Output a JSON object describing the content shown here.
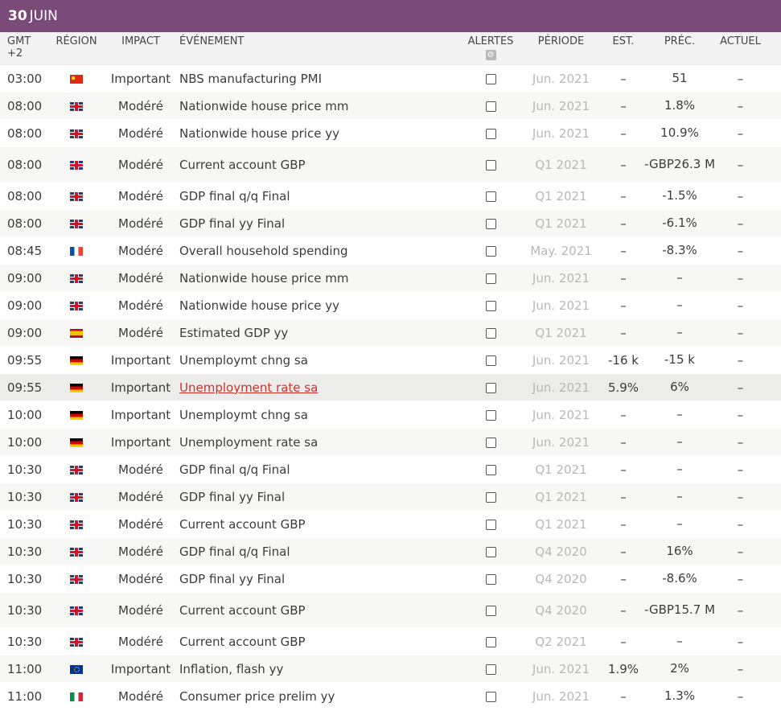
{
  "day": {
    "number": "30",
    "month": "JUIN"
  },
  "columns": {
    "time": "GMT +2",
    "region": "RÉGION",
    "impact": "IMPACT",
    "event": "ÉVÉNEMENT",
    "alerts": "ALERTES",
    "period": "PÉRIODE",
    "est": "EST.",
    "prec": "PRÉC.",
    "actual": "ACTUEL"
  },
  "rows": [
    {
      "time": "03:00",
      "flag": "cn",
      "impact": "Important",
      "event": "NBS manufacturing PMI",
      "period": "Jun. 2021",
      "est": "–",
      "prec": "51",
      "actual": "–"
    },
    {
      "time": "08:00",
      "flag": "gb",
      "impact": "Modéré",
      "event": "Nationwide house price mm",
      "period": "Jun. 2021",
      "est": "–",
      "prec": "1.8%",
      "actual": "–"
    },
    {
      "time": "08:00",
      "flag": "gb",
      "impact": "Modéré",
      "event": "Nationwide house price yy",
      "period": "Jun. 2021",
      "est": "–",
      "prec": "10.9%",
      "actual": "–"
    },
    {
      "time": "08:00",
      "flag": "gb",
      "impact": "Modéré",
      "event": "Current account GBP",
      "period": "Q1 2021",
      "est": "–",
      "prec": "-GBP26.3 M",
      "actual": "–",
      "tall": true
    },
    {
      "time": "08:00",
      "flag": "gb",
      "impact": "Modéré",
      "event": "GDP final q/q Final",
      "period": "Q1 2021",
      "est": "–",
      "prec": "-1.5%",
      "actual": "–"
    },
    {
      "time": "08:00",
      "flag": "gb",
      "impact": "Modéré",
      "event": "GDP final yy Final",
      "period": "Q1 2021",
      "est": "–",
      "prec": "-6.1%",
      "actual": "–"
    },
    {
      "time": "08:45",
      "flag": "fr",
      "impact": "Modéré",
      "event": "Overall household spending",
      "period": "May. 2021",
      "est": "–",
      "prec": "-8.3%",
      "actual": "–"
    },
    {
      "time": "09:00",
      "flag": "gb",
      "impact": "Modéré",
      "event": "Nationwide house price mm",
      "period": "Jun. 2021",
      "est": "–",
      "prec": "–",
      "actual": "–"
    },
    {
      "time": "09:00",
      "flag": "gb",
      "impact": "Modéré",
      "event": "Nationwide house price yy",
      "period": "Jun. 2021",
      "est": "–",
      "prec": "–",
      "actual": "–"
    },
    {
      "time": "09:00",
      "flag": "es",
      "impact": "Modéré",
      "event": "Estimated GDP yy",
      "period": "Q1 2021",
      "est": "–",
      "prec": "–",
      "actual": "–"
    },
    {
      "time": "09:55",
      "flag": "de",
      "impact": "Important",
      "event": "Unemploymt chng sa",
      "period": "Jun. 2021",
      "est": "-16 k",
      "prec": "-15 k",
      "actual": "–"
    },
    {
      "time": "09:55",
      "flag": "de",
      "impact": "Important",
      "event": "Unemployment rate sa",
      "period": "Jun. 2021",
      "est": "5.9%",
      "prec": "6%",
      "actual": "–",
      "selected": true
    },
    {
      "time": "10:00",
      "flag": "de",
      "impact": "Important",
      "event": "Unemploymt chng sa",
      "period": "Jun. 2021",
      "est": "–",
      "prec": "–",
      "actual": "–"
    },
    {
      "time": "10:00",
      "flag": "de",
      "impact": "Important",
      "event": "Unemployment rate sa",
      "period": "Jun. 2021",
      "est": "–",
      "prec": "–",
      "actual": "–"
    },
    {
      "time": "10:30",
      "flag": "gb",
      "impact": "Modéré",
      "event": "GDP final q/q Final",
      "period": "Q1 2021",
      "est": "–",
      "prec": "–",
      "actual": "–"
    },
    {
      "time": "10:30",
      "flag": "gb",
      "impact": "Modéré",
      "event": "GDP final yy Final",
      "period": "Q1 2021",
      "est": "–",
      "prec": "–",
      "actual": "–"
    },
    {
      "time": "10:30",
      "flag": "gb",
      "impact": "Modéré",
      "event": "Current account GBP",
      "period": "Q1 2021",
      "est": "–",
      "prec": "–",
      "actual": "–"
    },
    {
      "time": "10:30",
      "flag": "gb",
      "impact": "Modéré",
      "event": "GDP final q/q Final",
      "period": "Q4 2020",
      "est": "–",
      "prec": "16%",
      "actual": "–"
    },
    {
      "time": "10:30",
      "flag": "gb",
      "impact": "Modéré",
      "event": "GDP final yy Final",
      "period": "Q4 2020",
      "est": "–",
      "prec": "-8.6%",
      "actual": "–"
    },
    {
      "time": "10:30",
      "flag": "gb",
      "impact": "Modéré",
      "event": "Current account GBP",
      "period": "Q4 2020",
      "est": "–",
      "prec": "-GBP15.7 M",
      "actual": "–",
      "tall": true
    },
    {
      "time": "10:30",
      "flag": "gb",
      "impact": "Modéré",
      "event": "Current account GBP",
      "period": "Q2 2021",
      "est": "–",
      "prec": "–",
      "actual": "–"
    },
    {
      "time": "11:00",
      "flag": "eu",
      "impact": "Important",
      "event": "Inflation, flash yy",
      "period": "Jun. 2021",
      "est": "1.9%",
      "prec": "2%",
      "actual": "–"
    },
    {
      "time": "11:00",
      "flag": "it",
      "impact": "Modéré",
      "event": "Consumer price prelim yy",
      "period": "Jun. 2021",
      "est": "–",
      "prec": "1.3%",
      "actual": "–"
    }
  ],
  "icons": {
    "alert_settings": "gear-icon",
    "alert_toggle": "checkbox-icon"
  },
  "colors": {
    "header_bar": "#7a4a78",
    "link": "#d1312b"
  }
}
